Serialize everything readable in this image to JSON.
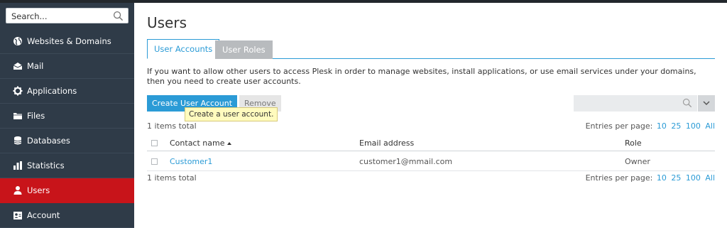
{
  "sidebar": {
    "search_placeholder": "Search...",
    "items": [
      {
        "label": "Websites & Domains",
        "icon": "globe-icon"
      },
      {
        "label": "Mail",
        "icon": "mail-icon"
      },
      {
        "label": "Applications",
        "icon": "gear-icon"
      },
      {
        "label": "Files",
        "icon": "folder-icon"
      },
      {
        "label": "Databases",
        "icon": "database-icon"
      },
      {
        "label": "Statistics",
        "icon": "bar-chart-icon"
      },
      {
        "label": "Users",
        "icon": "user-icon",
        "active": true
      },
      {
        "label": "Account",
        "icon": "account-icon"
      }
    ]
  },
  "main": {
    "title": "Users",
    "tabs": [
      {
        "label": "User Accounts",
        "active": true
      },
      {
        "label": "User Roles",
        "active": false
      }
    ],
    "description": "If you want to allow other users to access Plesk in order to manage websites, install applications, or use email services under your domains, then you need to create user accounts.",
    "toolbar": {
      "create_label": "Create User Account",
      "remove_label": "Remove",
      "tooltip": "Create a user account."
    },
    "items_total": "1 items total",
    "entries_label": "Entries per page:",
    "entries_options": [
      "10",
      "25",
      "100",
      "All"
    ],
    "table": {
      "columns": [
        "Contact name",
        "Email address",
        "Role"
      ],
      "rows": [
        {
          "name": "Customer1",
          "email": "customer1@mmail.com",
          "role": "Owner"
        }
      ]
    }
  },
  "colors": {
    "accent": "#2b9bd6",
    "sidebar_bg": "#2f3b48",
    "active_nav": "#c8141a"
  }
}
